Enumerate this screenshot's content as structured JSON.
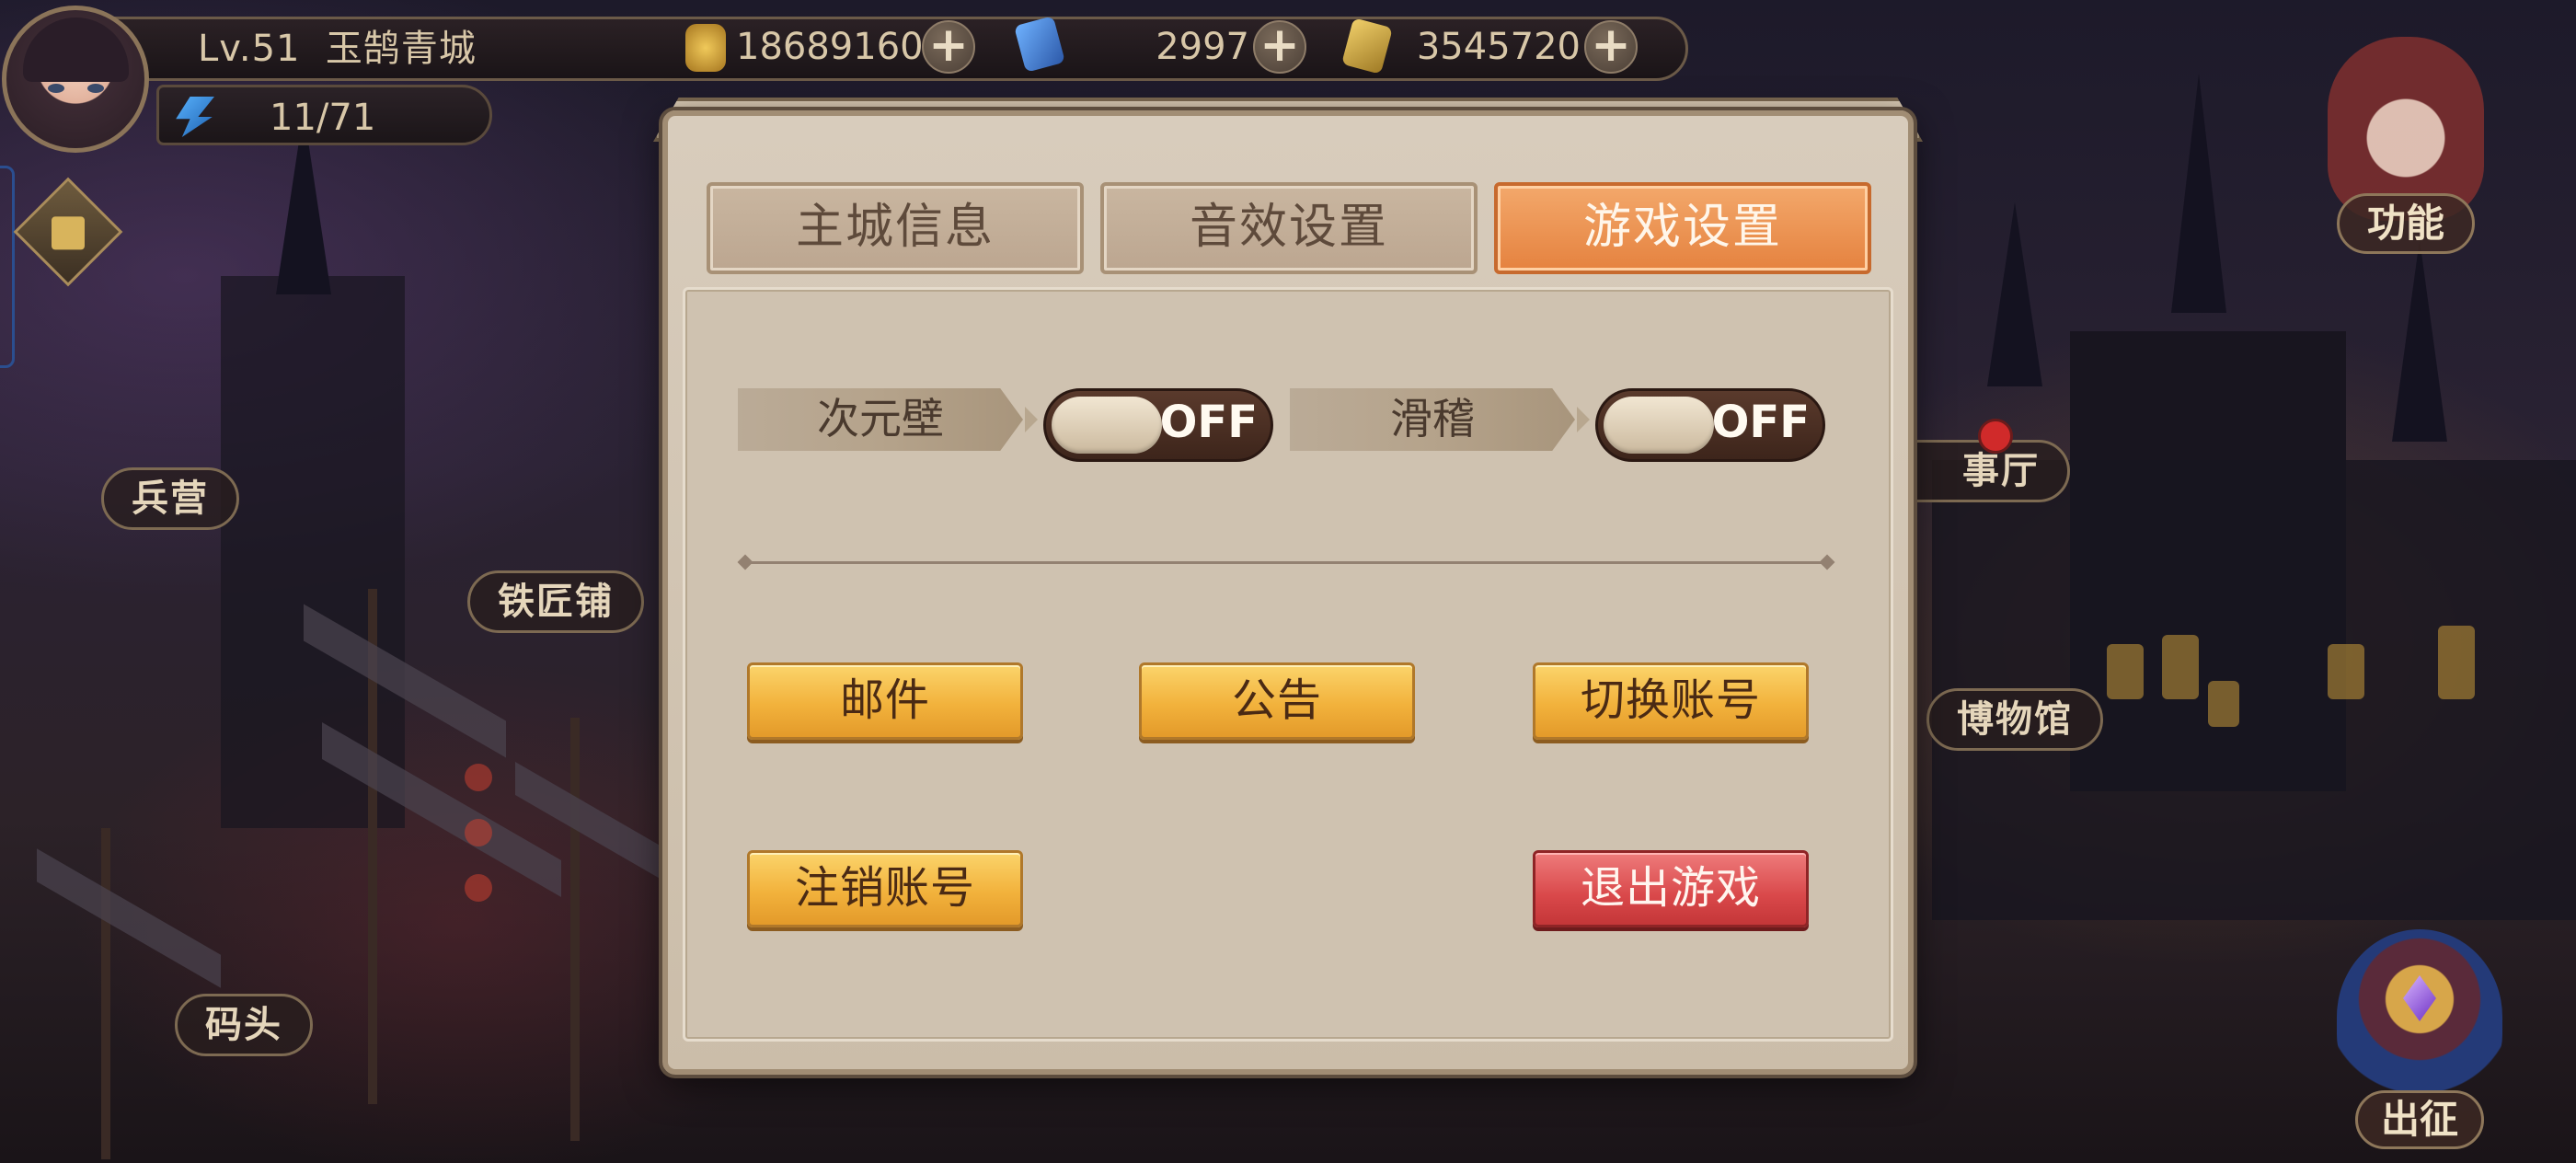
{
  "player": {
    "level": "Lv.51",
    "city_name": "玉鹄青城",
    "energy": "11/71"
  },
  "resources": [
    {
      "icon": "gold-coin-icon",
      "value": "18689160",
      "color": "#d4a63a"
    },
    {
      "icon": "blue-gem-card-icon",
      "value": "2997",
      "color": "#3b7fd4"
    },
    {
      "icon": "gold-ticket-icon",
      "value": "3545720",
      "color": "#c9a23a"
    }
  ],
  "map_labels": {
    "barracks": "兵营",
    "blacksmith": "铁匠铺",
    "dock": "码头",
    "hall_partial": "事厅",
    "museum": "博物馆"
  },
  "side_buttons": {
    "function": "功能",
    "expedition": "出征"
  },
  "dialog": {
    "tabs": [
      {
        "label": "主城信息",
        "active": false
      },
      {
        "label": "音效设置",
        "active": false
      },
      {
        "label": "游戏设置",
        "active": true
      }
    ],
    "toggles": [
      {
        "label": "次元壁",
        "state": "OFF"
      },
      {
        "label": "滑稽",
        "state": "OFF"
      }
    ],
    "buttons": {
      "mail": "邮件",
      "announcement": "公告",
      "switch_account": "切换账号",
      "logout_account": "注销账号",
      "exit_game": "退出游戏"
    }
  },
  "colors": {
    "active_tab": "#e5823f",
    "button_gold": "#f2b23c",
    "button_danger": "#d9484a"
  }
}
